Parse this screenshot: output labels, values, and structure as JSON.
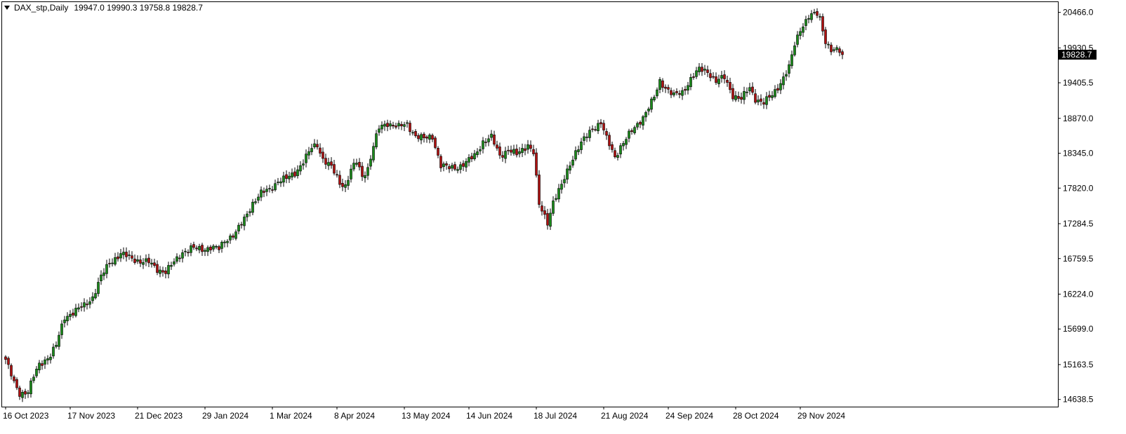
{
  "header": {
    "symbol": "DAX_stp,Daily",
    "ohlc": "19947.0 19990.3 19758.8 19828.7"
  },
  "colors": {
    "bull": "#1a8a1a",
    "bear": "#b01010",
    "wick": "#000000",
    "axis": "#000000",
    "price_tag_bg": "#000000",
    "price_tag_fg": "#ffffff"
  },
  "chart_data": {
    "type": "candlestick",
    "title": "DAX_stp,Daily",
    "ylim": [
      14530,
      20620
    ],
    "y_ticks": [
      "20466.0",
      "19930.5",
      "19405.5",
      "18870.0",
      "18345.0",
      "17820.0",
      "17284.5",
      "16759.5",
      "16224.0",
      "15699.0",
      "15163.5",
      "14638.5"
    ],
    "x_ticks": [
      {
        "label": "16 Oct 2023",
        "index": 0
      },
      {
        "label": "17 Nov 2023",
        "index": 23
      },
      {
        "label": "21 Dec 2023",
        "index": 47
      },
      {
        "label": "29 Jan 2024",
        "index": 71
      },
      {
        "label": "1 Mar 2024",
        "index": 95
      },
      {
        "label": "8 Apr 2024",
        "index": 118
      },
      {
        "label": "13 May 2024",
        "index": 142
      },
      {
        "label": "14 Jun 2024",
        "index": 165
      },
      {
        "label": "18 Jul 2024",
        "index": 189
      },
      {
        "label": "21 Aug 2024",
        "index": 213
      },
      {
        "label": "24 Sep 2024",
        "index": 236
      },
      {
        "label": "28 Oct 2024",
        "index": 260
      },
      {
        "label": "29 Nov 2024",
        "index": 283
      }
    ],
    "current_price": "19828.7",
    "keypoints": [
      [
        0,
        15240
      ],
      [
        3,
        14880
      ],
      [
        5,
        14730
      ],
      [
        8,
        14760
      ],
      [
        10,
        14980
      ],
      [
        12,
        15160
      ],
      [
        16,
        15310
      ],
      [
        18,
        15450
      ],
      [
        21,
        15880
      ],
      [
        24,
        15950
      ],
      [
        28,
        16050
      ],
      [
        31,
        16180
      ],
      [
        34,
        16480
      ],
      [
        37,
        16700
      ],
      [
        41,
        16830
      ],
      [
        45,
        16760
      ],
      [
        48,
        16720
      ],
      [
        51,
        16700
      ],
      [
        54,
        16600
      ],
      [
        57,
        16560
      ],
      [
        60,
        16700
      ],
      [
        63,
        16860
      ],
      [
        66,
        16910
      ],
      [
        70,
        16900
      ],
      [
        73,
        16930
      ],
      [
        76,
        16900
      ],
      [
        78,
        17030
      ],
      [
        82,
        17150
      ],
      [
        85,
        17350
      ],
      [
        88,
        17600
      ],
      [
        91,
        17740
      ],
      [
        94,
        17800
      ],
      [
        97,
        17930
      ],
      [
        100,
        17960
      ],
      [
        103,
        18050
      ],
      [
        106,
        18220
      ],
      [
        109,
        18420
      ],
      [
        111,
        18480
      ],
      [
        113,
        18260
      ],
      [
        116,
        18130
      ],
      [
        119,
        17900
      ],
      [
        121,
        17860
      ],
      [
        123,
        18090
      ],
      [
        125,
        18210
      ],
      [
        127,
        18000
      ],
      [
        129,
        18120
      ],
      [
        131,
        18450
      ],
      [
        133,
        18720
      ],
      [
        136,
        18800
      ],
      [
        140,
        18740
      ],
      [
        143,
        18780
      ],
      [
        146,
        18610
      ],
      [
        149,
        18560
      ],
      [
        152,
        18600
      ],
      [
        155,
        18160
      ],
      [
        158,
        18120
      ],
      [
        161,
        18140
      ],
      [
        164,
        18200
      ],
      [
        167,
        18310
      ],
      [
        170,
        18520
      ],
      [
        173,
        18580
      ],
      [
        176,
        18310
      ],
      [
        179,
        18400
      ],
      [
        182,
        18320
      ],
      [
        186,
        18480
      ],
      [
        188,
        18360
      ],
      [
        190,
        17560
      ],
      [
        193,
        17310
      ],
      [
        195,
        17620
      ],
      [
        198,
        17850
      ],
      [
        201,
        18190
      ],
      [
        203,
        18370
      ],
      [
        206,
        18550
      ],
      [
        209,
        18720
      ],
      [
        212,
        18810
      ],
      [
        214,
        18560
      ],
      [
        217,
        18290
      ],
      [
        219,
        18450
      ],
      [
        222,
        18620
      ],
      [
        225,
        18780
      ],
      [
        228,
        18960
      ],
      [
        231,
        19180
      ],
      [
        233,
        19430
      ],
      [
        235,
        19340
      ],
      [
        238,
        19210
      ],
      [
        241,
        19260
      ],
      [
        244,
        19470
      ],
      [
        247,
        19600
      ],
      [
        250,
        19580
      ],
      [
        253,
        19430
      ],
      [
        256,
        19480
      ],
      [
        259,
        19220
      ],
      [
        262,
        19160
      ],
      [
        265,
        19330
      ],
      [
        267,
        19170
      ],
      [
        270,
        19100
      ],
      [
        273,
        19220
      ],
      [
        276,
        19410
      ],
      [
        279,
        19630
      ],
      [
        281,
        19980
      ],
      [
        283,
        20220
      ],
      [
        286,
        20400
      ],
      [
        289,
        20440
      ],
      [
        290,
        20380
      ],
      [
        292,
        20040
      ],
      [
        294,
        19890
      ],
      [
        297,
        19880
      ],
      [
        298,
        19829
      ]
    ]
  }
}
